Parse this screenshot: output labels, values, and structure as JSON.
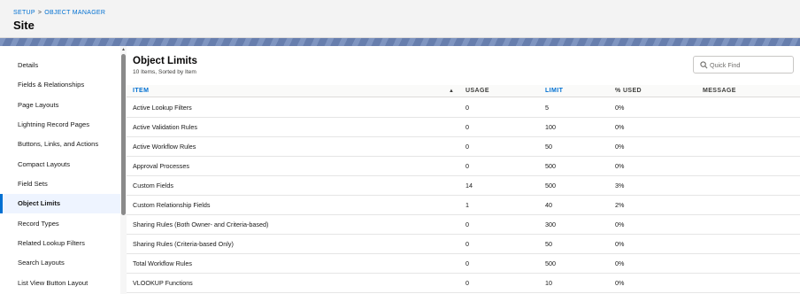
{
  "header": {
    "breadcrumb": [
      "SETUP",
      "OBJECT MANAGER"
    ],
    "breadcrumb_separator": ">",
    "title": "Site"
  },
  "sidebar": {
    "items": [
      {
        "label": "Details"
      },
      {
        "label": "Fields & Relationships"
      },
      {
        "label": "Page Layouts"
      },
      {
        "label": "Lightning Record Pages"
      },
      {
        "label": "Buttons, Links, and Actions"
      },
      {
        "label": "Compact Layouts"
      },
      {
        "label": "Field Sets"
      },
      {
        "label": "Object Limits"
      },
      {
        "label": "Record Types"
      },
      {
        "label": "Related Lookup Filters"
      },
      {
        "label": "Search Layouts"
      },
      {
        "label": "List View Button Layout"
      }
    ],
    "active_index": 7
  },
  "main": {
    "title": "Object Limits",
    "subtitle": "10 Items, Sorted by Item",
    "search": {
      "placeholder": "Quick Find",
      "value": ""
    },
    "columns": [
      "ITEM",
      "USAGE",
      "LIMIT",
      "% USED",
      "MESSAGE"
    ],
    "sort_indicator": "▲",
    "rows": [
      {
        "item": "Active Lookup Filters",
        "usage": "0",
        "limit": "5",
        "percent": "0%",
        "message": ""
      },
      {
        "item": "Active Validation Rules",
        "usage": "0",
        "limit": "100",
        "percent": "0%",
        "message": ""
      },
      {
        "item": "Active Workflow Rules",
        "usage": "0",
        "limit": "50",
        "percent": "0%",
        "message": ""
      },
      {
        "item": "Approval Processes",
        "usage": "0",
        "limit": "500",
        "percent": "0%",
        "message": ""
      },
      {
        "item": "Custom Fields",
        "usage": "14",
        "limit": "500",
        "percent": "3%",
        "message": ""
      },
      {
        "item": "Custom Relationship Fields",
        "usage": "1",
        "limit": "40",
        "percent": "2%",
        "message": ""
      },
      {
        "item": "Sharing Rules (Both Owner- and Criteria-based)",
        "usage": "0",
        "limit": "300",
        "percent": "0%",
        "message": ""
      },
      {
        "item": "Sharing Rules (Criteria-based Only)",
        "usage": "0",
        "limit": "50",
        "percent": "0%",
        "message": ""
      },
      {
        "item": "Total Workflow Rules",
        "usage": "0",
        "limit": "500",
        "percent": "0%",
        "message": ""
      },
      {
        "item": "VLOOKUP Functions",
        "usage": "0",
        "limit": "10",
        "percent": "0%",
        "message": ""
      }
    ]
  },
  "icons": {
    "search": "search-icon",
    "sort": "sort-ascending-icon"
  },
  "colors": {
    "link": "#0070d2",
    "header_bg": "#f3f3f3",
    "band": "#6d86b8",
    "active_bg": "#eef4ff"
  }
}
